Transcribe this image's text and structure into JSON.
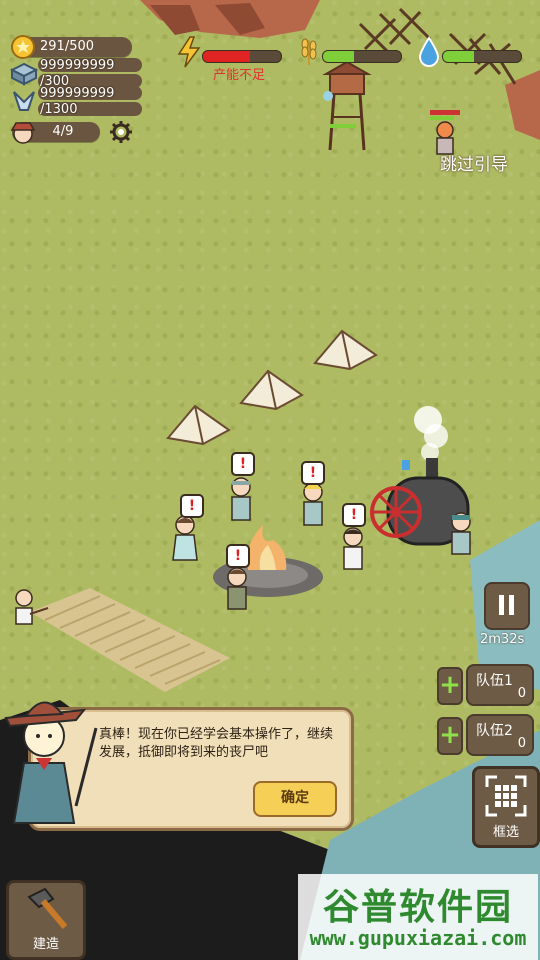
{
  "resources": {
    "gold": {
      "value": "291/500",
      "icon": "gold-coin-icon"
    },
    "stone": {
      "value": "999999999",
      "cap": "/300",
      "icon": "stone-ingot-icon"
    },
    "crystal": {
      "value": "999999999",
      "cap": "/1300",
      "icon": "crystal-icon"
    },
    "population": {
      "value": "4/9",
      "icon": "survivor-face-icon"
    }
  },
  "status_bars": {
    "energy": {
      "icon": "lightning-icon",
      "fill": 0.6,
      "color": "#e02424",
      "warning": "产能不足"
    },
    "food": {
      "icon": "wheat-icon",
      "fill": 0.4,
      "color": "#7fcf3a"
    },
    "water": {
      "icon": "water-drop-icon",
      "fill": 0.4,
      "color": "#7fcf3a"
    }
  },
  "skip_guide": "跳过引导",
  "timer": "2m32s",
  "teams": [
    {
      "label": "队伍1",
      "count": "0"
    },
    {
      "label": "队伍2",
      "count": "0"
    }
  ],
  "select_label": "框选",
  "build_label": "建造",
  "dialog": {
    "text": "真棒！现在你已经学会基本操作了，继续发展，抵御即将到来的丧尸吧",
    "ok": "确定"
  },
  "watermark": {
    "title": "谷普软件园",
    "url": "www.gupuxiazai.com"
  },
  "alerts": "!",
  "colors": {
    "accent": "#f6cf57",
    "panel": "#6e5b46",
    "grass": "#aebb62"
  }
}
